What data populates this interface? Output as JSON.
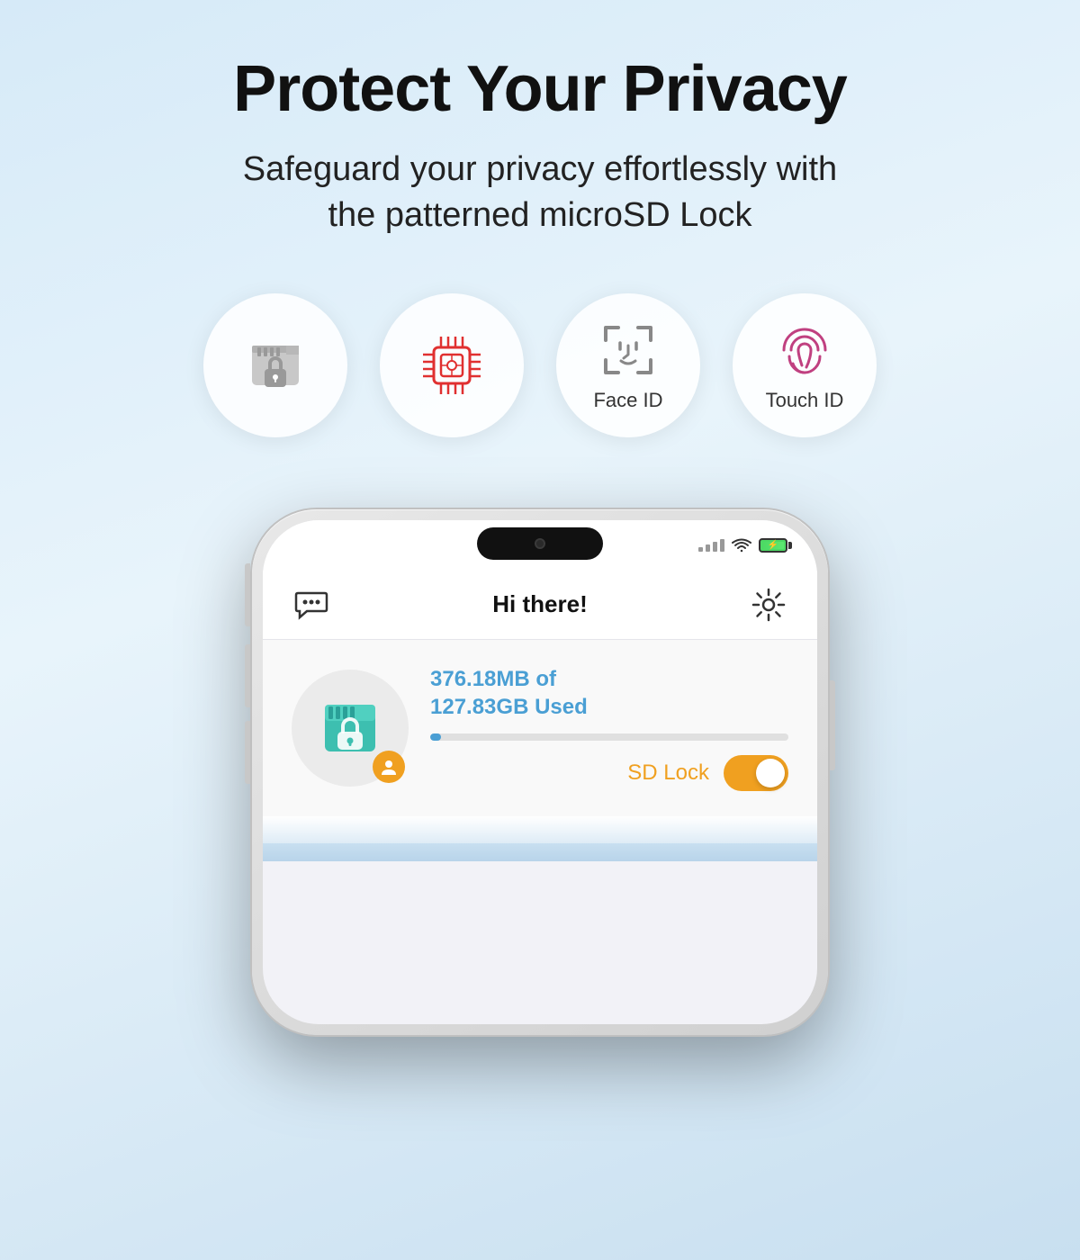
{
  "page": {
    "background": "linear-gradient(160deg, #d6eaf8 0%, #e8f4fb 40%, #c8dff0 100%)"
  },
  "header": {
    "headline": "Protect Your Privacy",
    "subtitle_line1": "Safeguard your privacy effortlessly with",
    "subtitle_line2": "the patterned microSD Lock"
  },
  "feature_icons": [
    {
      "id": "sd-lock",
      "label": "",
      "type": "sd-lock-icon"
    },
    {
      "id": "chip",
      "label": "",
      "type": "chip-icon"
    },
    {
      "id": "face-id",
      "label": "Face ID",
      "type": "face-id-icon"
    },
    {
      "id": "touch-id",
      "label": "Touch ID",
      "type": "touch-id-icon"
    }
  ],
  "phone": {
    "status_bar": {
      "signal_label": "signal",
      "wifi_label": "wifi",
      "battery_label": "battery"
    },
    "app": {
      "header_title": "Hi there!",
      "chat_icon_label": "chat",
      "settings_icon_label": "settings",
      "storage_line1": "376.18MB of",
      "storage_line2": "127.83GB Used",
      "progress_percent": 3,
      "sd_lock_label": "SD Lock",
      "toggle_state": "on"
    }
  }
}
